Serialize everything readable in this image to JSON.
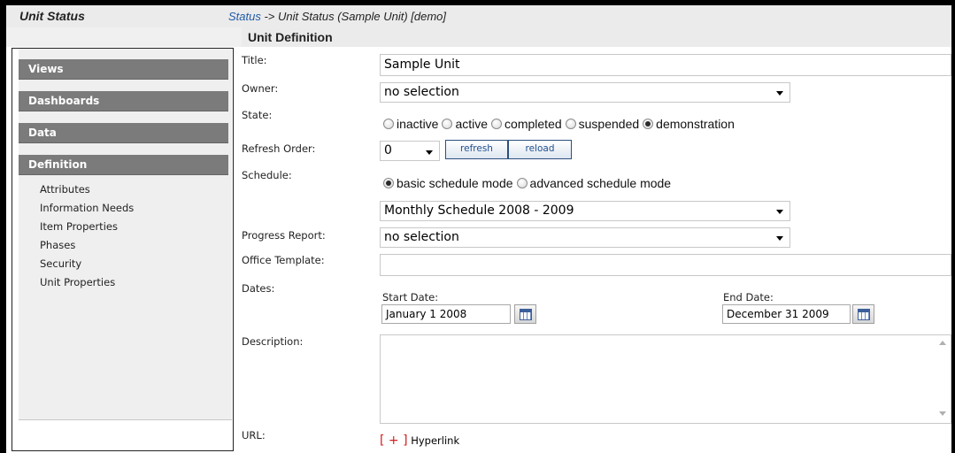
{
  "topbar": {
    "app_title": "Unit Status",
    "breadcrumb_link": "Status",
    "breadcrumb_rest": " -> Unit Status (Sample Unit) [demo]"
  },
  "section": {
    "title": "Unit Definition"
  },
  "sidebar": {
    "views": "Views",
    "dashboards": "Dashboards",
    "data": "Data",
    "definition": "Definition",
    "items": [
      "Attributes",
      "Information Needs",
      "Item Properties",
      "Phases",
      "Security",
      "Unit Properties"
    ]
  },
  "form": {
    "title_label": "Title:",
    "title_value": "Sample Unit",
    "owner_label": "Owner:",
    "owner_value": "no selection",
    "state_label": "State:",
    "state_options": [
      "inactive",
      "active",
      "completed",
      "suspended",
      "demonstration"
    ],
    "state_selected": "demonstration",
    "refresh_label": "Refresh Order:",
    "refresh_value": "0",
    "refresh_button": "refresh",
    "reload_button": "reload",
    "schedule_label": "Schedule:",
    "schedule_modes": [
      "basic schedule mode",
      "advanced schedule mode"
    ],
    "schedule_mode_selected": "basic schedule mode",
    "schedule_value": "Monthly Schedule 2008 - 2009",
    "progress_label": "Progress Report:",
    "progress_value": "no selection",
    "office_label": "Office Template:",
    "office_value": "",
    "dates_label": "Dates:",
    "start_label": "Start Date:",
    "start_value": "January   1 2008",
    "end_label": "End Date:",
    "end_value": "December  31 2009",
    "description_label": "Description:",
    "description_value": "",
    "url_label": "URL:",
    "url_add": "[ + ]",
    "url_text": "Hyperlink"
  },
  "colors": {
    "link_blue": "#1f5aa8",
    "sidebar_header": "#7b7b7b",
    "button_border": "#2c4f7d",
    "hyperlink_bracket": "#d02020"
  }
}
